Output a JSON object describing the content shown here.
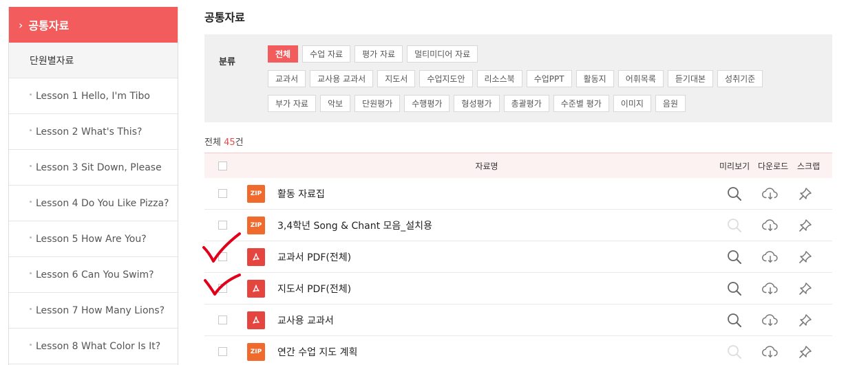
{
  "sidebar": {
    "active": "공통자료",
    "sub": "단원별자료",
    "lessons": [
      "Lesson 1 Hello, I'm Tibo",
      "Lesson 2 What's This?",
      "Lesson 3 Sit Down, Please",
      "Lesson 4 Do You Like Pizza?",
      "Lesson 5 How Are You?",
      "Lesson 6 Can You Swim?",
      "Lesson 7 How Many Lions?",
      "Lesson 8 What Color Is It?"
    ]
  },
  "page_title": "공통자료",
  "filter": {
    "label": "분류",
    "row1": [
      "전체",
      "수업 자료",
      "평가 자료",
      "멀티미디어 자료"
    ],
    "row2": [
      "교과서",
      "교사용 교과서",
      "지도서",
      "수업지도안",
      "리소스북",
      "수업PPT",
      "활동지",
      "어휘목록",
      "듣기대본",
      "성취기준"
    ],
    "row3": [
      "부가 자료",
      "악보",
      "단원평가",
      "수행평가",
      "형성평가",
      "총괄평가",
      "수준별 평가",
      "이미지",
      "음원"
    ]
  },
  "count": {
    "prefix": "전체 ",
    "num": "45",
    "suffix": "건"
  },
  "table": {
    "col_name": "자료명",
    "col_preview": "미리보기",
    "col_download": "다운로드",
    "col_scrap": "스크랩",
    "rows": [
      {
        "type": "ZIP",
        "name": "활동 자료집",
        "preview": true
      },
      {
        "type": "ZIP",
        "name": "3,4학년 Song & Chant 모음_설치용",
        "preview": false
      },
      {
        "type": "PDF",
        "name": "교과서 PDF(전체)",
        "preview": true
      },
      {
        "type": "PDF",
        "name": "지도서 PDF(전체)",
        "preview": true
      },
      {
        "type": "PDF",
        "name": "교사용 교과서",
        "preview": true
      },
      {
        "type": "ZIP",
        "name": "연간 수업 지도 계획",
        "preview": false
      }
    ]
  },
  "colors": {
    "accent": "#f25c5c",
    "count_red": "#e84848",
    "check_red": "#e0001b"
  }
}
